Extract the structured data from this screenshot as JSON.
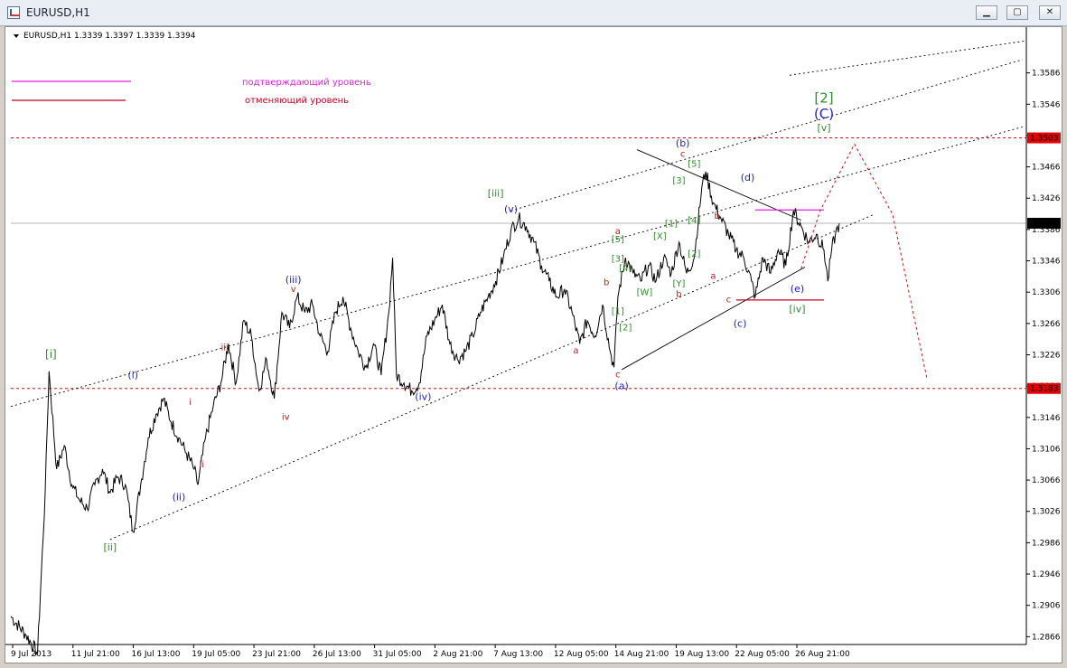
{
  "window": {
    "title": "EURUSD,H1",
    "buttons": {
      "minimize": "▁",
      "maximize": "▢",
      "close": "✕"
    }
  },
  "chart_data": {
    "type": "line",
    "symbol_header": "EURUSD,H1  1.3339 1.3397 1.3339 1.3394",
    "ylim": [
      1.2856,
      1.3626
    ],
    "y_ticks": [
      "1.3586",
      "1.3546",
      "1.3506",
      "1.3466",
      "1.3426",
      "1.3386",
      "1.3346",
      "1.3306",
      "1.3266",
      "1.3226",
      "1.3186",
      "1.3146",
      "1.3106",
      "1.3066",
      "1.3026",
      "1.2986",
      "1.2946",
      "1.2906",
      "1.2866"
    ],
    "x_ticks": [
      "9 Jul 2013",
      "11 Jul 21:00",
      "16 Jul 13:00",
      "19 Jul 05:00",
      "23 Jul 21:00",
      "26 Jul 13:00",
      "31 Jul 05:00",
      "2 Aug 21:00",
      "7 Aug 13:00",
      "12 Aug 05:00",
      "14 Aug 21:00",
      "19 Aug 13:00",
      "22 Aug 05:00",
      "26 Aug 21:00"
    ],
    "grid": false,
    "legend": [
      {
        "name": "подтверждающий уровень",
        "color": "#e020e0"
      },
      {
        "name": "отменяющий уровень",
        "color": "#c80020"
      }
    ],
    "price_labels": {
      "current": "1.3394",
      "upper_level": "1.3503",
      "lower_level": "1.3183"
    },
    "levels": {
      "current": 1.3394,
      "upper": 1.3503,
      "lower": 1.3183
    },
    "price_path": [
      [
        0,
        1.2892
      ],
      [
        4,
        1.2868
      ],
      [
        7,
        1.2845
      ],
      [
        9,
        1.305
      ],
      [
        10,
        1.3205
      ],
      [
        12,
        1.308
      ],
      [
        14,
        1.311
      ],
      [
        16,
        1.306
      ],
      [
        18,
        1.304
      ],
      [
        20,
        1.303
      ],
      [
        22,
        1.306
      ],
      [
        24,
        1.308
      ],
      [
        26,
        1.305
      ],
      [
        28,
        1.307
      ],
      [
        30,
        1.306
      ],
      [
        32,
        1.3
      ],
      [
        34,
        1.306
      ],
      [
        36,
        1.312
      ],
      [
        38,
        1.315
      ],
      [
        40,
        1.317
      ],
      [
        42,
        1.314
      ],
      [
        44,
        1.312
      ],
      [
        46,
        1.31
      ],
      [
        48,
        1.308
      ],
      [
        49,
        1.306
      ],
      [
        51,
        1.312
      ],
      [
        53,
        1.316
      ],
      [
        55,
        1.319
      ],
      [
        57,
        1.324
      ],
      [
        59,
        1.319
      ],
      [
        61,
        1.327
      ],
      [
        63,
        1.325
      ],
      [
        65,
        1.318
      ],
      [
        67,
        1.322
      ],
      [
        69,
        1.317
      ],
      [
        71,
        1.328
      ],
      [
        73,
        1.326
      ],
      [
        75,
        1.33
      ],
      [
        77,
        1.328
      ],
      [
        79,
        1.329
      ],
      [
        81,
        1.325
      ],
      [
        83,
        1.323
      ],
      [
        85,
        1.328
      ],
      [
        87,
        1.33
      ],
      [
        89,
        1.326
      ],
      [
        91,
        1.323
      ],
      [
        93,
        1.321
      ],
      [
        95,
        1.324
      ],
      [
        97,
        1.32
      ],
      [
        99,
        1.328
      ],
      [
        100,
        1.335
      ],
      [
        101,
        1.32
      ],
      [
        103,
        1.319
      ],
      [
        105,
        1.318
      ],
      [
        107,
        1.319
      ],
      [
        109,
        1.325
      ],
      [
        111,
        1.327
      ],
      [
        113,
        1.329
      ],
      [
        115,
        1.324
      ],
      [
        117,
        1.322
      ],
      [
        119,
        1.323
      ],
      [
        121,
        1.325
      ],
      [
        123,
        1.328
      ],
      [
        125,
        1.33
      ],
      [
        127,
        1.332
      ],
      [
        129,
        1.335
      ],
      [
        131,
        1.3385
      ],
      [
        133,
        1.34
      ],
      [
        135,
        1.339
      ],
      [
        137,
        1.337
      ],
      [
        139,
        1.334
      ],
      [
        141,
        1.332
      ],
      [
        143,
        1.33
      ],
      [
        145,
        1.331
      ],
      [
        147,
        1.328
      ],
      [
        149,
        1.324
      ],
      [
        151,
        1.327
      ],
      [
        153,
        1.325
      ],
      [
        155,
        1.329
      ],
      [
        157,
        1.323
      ],
      [
        158,
        1.321
      ],
      [
        159,
        1.33
      ],
      [
        161,
        1.335
      ],
      [
        163,
        1.333
      ],
      [
        165,
        1.332
      ],
      [
        167,
        1.334
      ],
      [
        169,
        1.332
      ],
      [
        171,
        1.335
      ],
      [
        173,
        1.333
      ],
      [
        175,
        1.337
      ],
      [
        177,
        1.333
      ],
      [
        179,
        1.335
      ],
      [
        181,
        1.344
      ],
      [
        182,
        1.346
      ],
      [
        184,
        1.342
      ],
      [
        186,
        1.34
      ],
      [
        188,
        1.338
      ],
      [
        190,
        1.336
      ],
      [
        192,
        1.335
      ],
      [
        194,
        1.332
      ],
      [
        195,
        1.33
      ],
      [
        197,
        1.335
      ],
      [
        199,
        1.333
      ],
      [
        201,
        1.336
      ],
      [
        203,
        1.334
      ],
      [
        205,
        1.341
      ],
      [
        207,
        1.339
      ],
      [
        209,
        1.337
      ],
      [
        211,
        1.338
      ],
      [
        213,
        1.336
      ],
      [
        214,
        1.332
      ],
      [
        215,
        1.336
      ],
      [
        216,
        1.338
      ],
      [
        217,
        1.3394
      ]
    ],
    "annotations": [
      {
        "text": "[i]",
        "color": "#2e8b2e",
        "size": 12,
        "x": 10.5,
        "y": 1.3222
      },
      {
        "text": "[ii]",
        "color": "#2e8b2e",
        "size": 11,
        "x": 26,
        "y": 1.2976
      },
      {
        "text": "(i)",
        "color": "#2020c0",
        "size": 11,
        "x": 32,
        "y": 1.3196
      },
      {
        "text": "(ii)",
        "color": "#2020c0",
        "size": 11,
        "x": 44,
        "y": 1.304
      },
      {
        "text": "i",
        "color": "#b22222",
        "size": 10,
        "x": 47,
        "y": 1.3162
      },
      {
        "text": "ii",
        "color": "#b22222",
        "size": 10,
        "x": 50,
        "y": 1.3082
      },
      {
        "text": "iii",
        "color": "#b22222",
        "size": 10,
        "x": 56,
        "y": 1.3232
      },
      {
        "text": "iv",
        "color": "#b22222",
        "size": 10,
        "x": 72,
        "y": 1.3143
      },
      {
        "text": "v",
        "color": "#b22222",
        "size": 10,
        "x": 74,
        "y": 1.3306
      },
      {
        "text": "(iii)",
        "color": "#2020c0",
        "size": 11,
        "x": 74,
        "y": 1.3318
      },
      {
        "text": "(iv)",
        "color": "#2020c0",
        "size": 11,
        "x": 108,
        "y": 1.3168
      },
      {
        "text": "[iii]",
        "color": "#2e8b2e",
        "size": 11,
        "x": 127,
        "y": 1.3428
      },
      {
        "text": "(v)",
        "color": "#2020c0",
        "size": 11,
        "x": 131,
        "y": 1.3408
      },
      {
        "text": "a",
        "color": "#b22222",
        "size": 10,
        "x": 148,
        "y": 1.3228
      },
      {
        "text": "b",
        "color": "#b22222",
        "size": 10,
        "x": 156,
        "y": 1.3315
      },
      {
        "text": "c",
        "color": "#b22222",
        "size": 10,
        "x": 159,
        "y": 1.3197
      },
      {
        "text": "(a)",
        "color": "#2020c0",
        "size": 11,
        "x": 160,
        "y": 1.3182
      },
      {
        "text": "a",
        "color": "#b22222",
        "size": 10,
        "x": 159,
        "y": 1.338
      },
      {
        "text": "[5]",
        "color": "#2e8b2e",
        "size": 10,
        "x": 159,
        "y": 1.337
      },
      {
        "text": "[3]",
        "color": "#2e8b2e",
        "size": 10,
        "x": 159,
        "y": 1.3345
      },
      {
        "text": "[4]",
        "color": "#2e8b2e",
        "size": 10,
        "x": 161,
        "y": 1.3333
      },
      {
        "text": "[1]",
        "color": "#2e8b2e",
        "size": 10,
        "x": 159,
        "y": 1.3278
      },
      {
        "text": "[2]",
        "color": "#2e8b2e",
        "size": 10,
        "x": 161,
        "y": 1.3257
      },
      {
        "text": "[W]",
        "color": "#2e8b2e",
        "size": 10,
        "x": 166,
        "y": 1.3302
      },
      {
        "text": "[X]",
        "color": "#2e8b2e",
        "size": 10,
        "x": 170,
        "y": 1.3374
      },
      {
        "text": "[Y]",
        "color": "#2e8b2e",
        "size": 10,
        "x": 175,
        "y": 1.3313
      },
      {
        "text": "b",
        "color": "#b22222",
        "size": 10,
        "x": 175,
        "y": 1.33
      },
      {
        "text": "[1]",
        "color": "#2e8b2e",
        "size": 10,
        "x": 173,
        "y": 1.339
      },
      {
        "text": "[2]",
        "color": "#2e8b2e",
        "size": 10,
        "x": 179,
        "y": 1.3351
      },
      {
        "text": "[3]",
        "color": "#2e8b2e",
        "size": 10,
        "x": 175,
        "y": 1.3445
      },
      {
        "text": "[4]",
        "color": "#2e8b2e",
        "size": 10,
        "x": 179,
        "y": 1.3394
      },
      {
        "text": "[5]",
        "color": "#2e8b2e",
        "size": 10,
        "x": 179,
        "y": 1.3466
      },
      {
        "text": "c",
        "color": "#b22222",
        "size": 10,
        "x": 176,
        "y": 1.3479
      },
      {
        "text": "(b)",
        "color": "#2020c0",
        "size": 11,
        "x": 176,
        "y": 1.3492
      },
      {
        "text": "b",
        "color": "#b22222",
        "size": 10,
        "x": 185,
        "y": 1.34
      },
      {
        "text": "a",
        "color": "#b22222",
        "size": 10,
        "x": 184,
        "y": 1.3323
      },
      {
        "text": "c",
        "color": "#b22222",
        "size": 10,
        "x": 188,
        "y": 1.3293
      },
      {
        "text": "(c)",
        "color": "#2020c0",
        "size": 11,
        "x": 191,
        "y": 1.3262
      },
      {
        "text": "(d)",
        "color": "#2020c0",
        "size": 11,
        "x": 193,
        "y": 1.3448
      },
      {
        "text": "(e)",
        "color": "#2020c0",
        "size": 11,
        "x": 206,
        "y": 1.3306
      },
      {
        "text": "[iv]",
        "color": "#2e8b2e",
        "size": 11,
        "x": 206,
        "y": 1.328
      },
      {
        "text": "[v]",
        "color": "#2e8b2e",
        "size": 11,
        "x": 213,
        "y": 1.3512
      },
      {
        "text": "(C)",
        "color": "#2020c0",
        "size": 15,
        "x": 213,
        "y": 1.3528
      },
      {
        "text": "[2]",
        "color": "#2e8b2e",
        "size": 15,
        "x": 213,
        "y": 1.3548
      }
    ],
    "channel_lines": [
      {
        "style": "dotted",
        "color": "#000000",
        "x1": 26,
        "y1": 1.299,
        "x2": 226,
        "y2": 1.3405
      },
      {
        "style": "dotted",
        "color": "#000000",
        "x1": 131,
        "y1": 1.341,
        "x2": 265,
        "y2": 1.3603
      },
      {
        "style": "dotted",
        "color": "#000000",
        "x1": 204,
        "y1": 1.3583,
        "x2": 266,
        "y2": 1.3627
      },
      {
        "style": "dotted",
        "color": "#000000",
        "x1": 0,
        "y1": 1.316,
        "x2": 265,
        "y2": 1.3517
      },
      {
        "style": "solid",
        "color": "#000000",
        "x1": 164,
        "y1": 1.3488,
        "x2": 207,
        "y2": 1.3398
      },
      {
        "style": "solid",
        "color": "#000000",
        "x1": 160,
        "y1": 1.3207,
        "x2": 208,
        "y2": 1.3338
      }
    ],
    "projection": [
      [
        207,
        1.3336
      ],
      [
        212,
        1.341
      ],
      [
        221,
        1.3495
      ],
      [
        231,
        1.3405
      ],
      [
        240,
        1.3195
      ]
    ],
    "confirm_level": {
      "x1": 195,
      "x2": 213,
      "y": 1.3411
    },
    "cancel_level": {
      "x1": 190,
      "x2": 213,
      "y": 1.3296
    }
  }
}
